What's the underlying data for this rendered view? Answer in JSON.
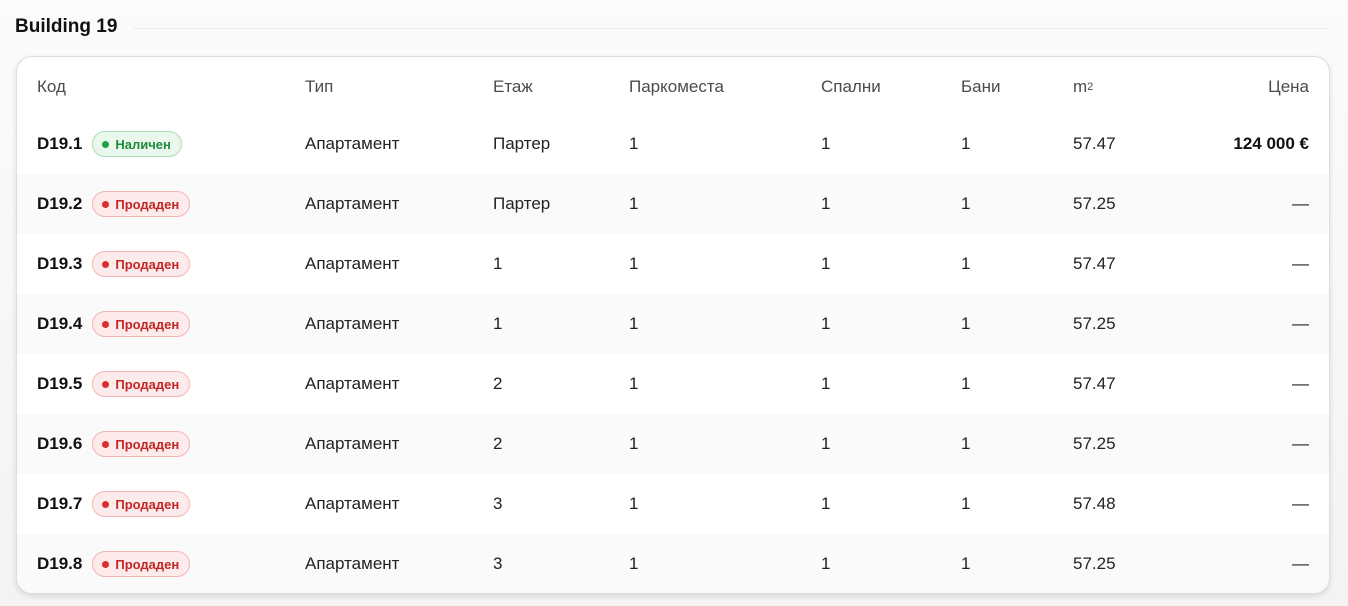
{
  "section": {
    "title": "Building 19"
  },
  "table": {
    "headers": {
      "code": "Код",
      "type": "Тип",
      "floor": "Етаж",
      "parking": "Паркоместа",
      "bedrooms": "Спални",
      "bathrooms": "Бани",
      "area": "m",
      "area_sup": "2",
      "price": "Цена"
    },
    "rows": [
      {
        "code": "D19.1",
        "status": "Наличен",
        "type": "Апартамент",
        "floor": "Партер",
        "parking": "1",
        "bedrooms": "1",
        "bathrooms": "1",
        "area": "57.47",
        "price": "124 000 €"
      },
      {
        "code": "D19.2",
        "status": "Продаден",
        "type": "Апартамент",
        "floor": "Партер",
        "parking": "1",
        "bedrooms": "1",
        "bathrooms": "1",
        "area": "57.25",
        "price": "—"
      },
      {
        "code": "D19.3",
        "status": "Продаден",
        "type": "Апартамент",
        "floor": "1",
        "parking": "1",
        "bedrooms": "1",
        "bathrooms": "1",
        "area": "57.47",
        "price": "—"
      },
      {
        "code": "D19.4",
        "status": "Продаден",
        "type": "Апартамент",
        "floor": "1",
        "parking": "1",
        "bedrooms": "1",
        "bathrooms": "1",
        "area": "57.25",
        "price": "—"
      },
      {
        "code": "D19.5",
        "status": "Продаден",
        "type": "Апартамент",
        "floor": "2",
        "parking": "1",
        "bedrooms": "1",
        "bathrooms": "1",
        "area": "57.47",
        "price": "—"
      },
      {
        "code": "D19.6",
        "status": "Продаден",
        "type": "Апартамент",
        "floor": "2",
        "parking": "1",
        "bedrooms": "1",
        "bathrooms": "1",
        "area": "57.25",
        "price": "—"
      },
      {
        "code": "D19.7",
        "status": "Продаден",
        "type": "Апартамент",
        "floor": "3",
        "parking": "1",
        "bedrooms": "1",
        "bathrooms": "1",
        "area": "57.48",
        "price": "—"
      },
      {
        "code": "D19.8",
        "status": "Продаден",
        "type": "Апартамент",
        "floor": "3",
        "parking": "1",
        "bedrooms": "1",
        "bathrooms": "1",
        "area": "57.25",
        "price": "—"
      }
    ]
  },
  "colors": {
    "available": "#22a047",
    "sold": "#d83030"
  }
}
